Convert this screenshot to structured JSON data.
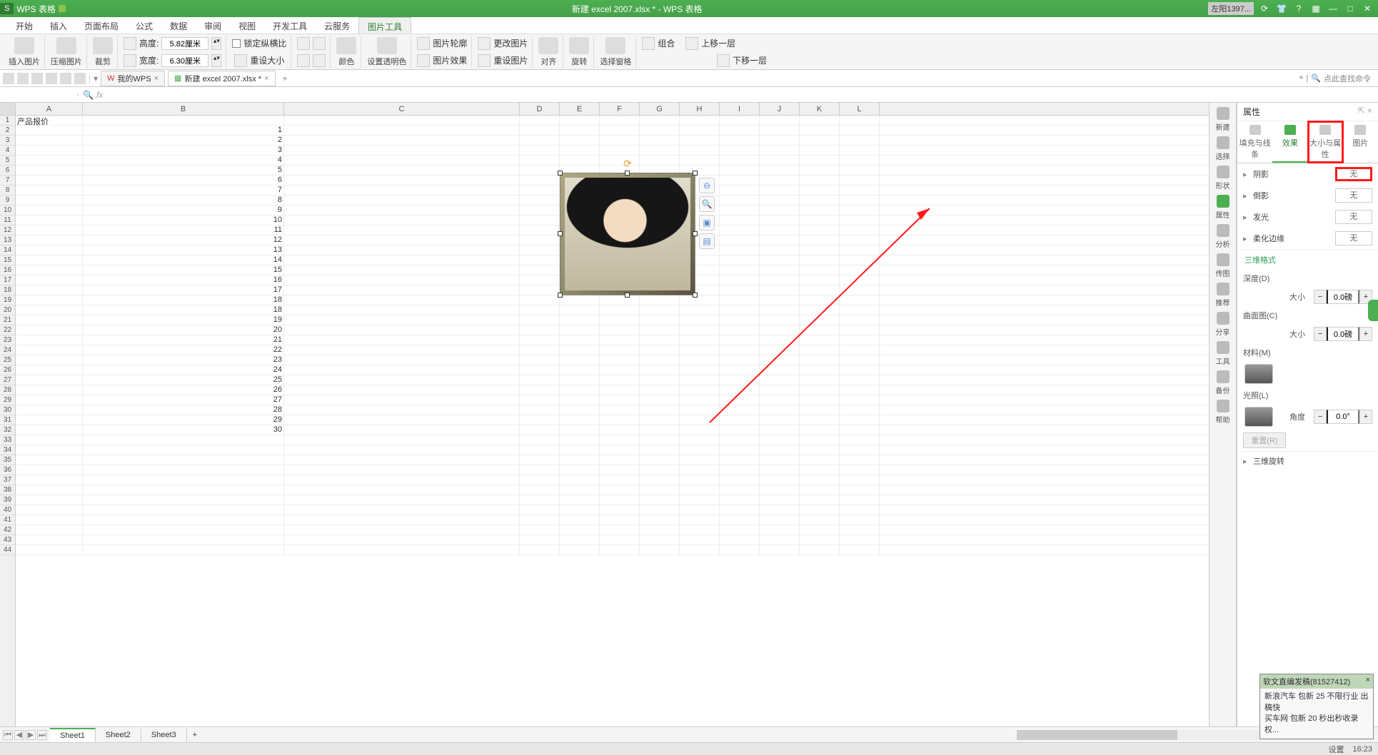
{
  "title": {
    "app": "WPS 表格",
    "doc": "新建 excel 2007.xlsx * - WPS 表格",
    "user": "左阳1397..."
  },
  "menu": {
    "items": [
      "开始",
      "插入",
      "页面布局",
      "公式",
      "数据",
      "审阅",
      "视图",
      "开发工具",
      "云服务",
      "图片工具"
    ],
    "active": 9
  },
  "ribbon": {
    "insertpic": "插入图片",
    "compress": "压缩图片",
    "crop": "裁剪",
    "height_lbl": "高度:",
    "height": "5.82厘米",
    "width_lbl": "宽度:",
    "width": "6.30厘米",
    "lock": "锁定纵横比",
    "resetsize": "重设大小",
    "border": "图片轮廓",
    "effect": "图片效果",
    "resetpic": "重设图片",
    "replace": "更改图片",
    "color": "颜色",
    "opacity": "设置透明色",
    "rotate": "旋转",
    "selpane": "选择窗格",
    "align": "对齐",
    "group": "组合",
    "front": "上移一层",
    "back": "下移一层"
  },
  "qat": {
    "mywps": "我的WPS",
    "doc": "新建 excel 2007.xlsx *",
    "search": "点此查找命令"
  },
  "namebox": "",
  "fx": "fx",
  "cols": [
    "A",
    "B",
    "C",
    "D",
    "E",
    "F",
    "G",
    "H",
    "I",
    "J",
    "K",
    "L"
  ],
  "a1": "产品报价",
  "bvalues": [
    "1",
    "2",
    "3",
    "4",
    "5",
    "6",
    "7",
    "8",
    "9",
    "10",
    "11",
    "12",
    "13",
    "14",
    "15",
    "16",
    "17",
    "18",
    "18",
    "19",
    "20",
    "21",
    "22",
    "23",
    "24",
    "25",
    "26",
    "27",
    "28",
    "29",
    "30"
  ],
  "rail": [
    {
      "l": "新建"
    },
    {
      "l": "选择"
    },
    {
      "l": "形状"
    },
    {
      "l": "属性",
      "g": true
    },
    {
      "l": "分析"
    },
    {
      "l": "传图"
    },
    {
      "l": "推荐"
    },
    {
      "l": "分享"
    },
    {
      "l": "工具"
    },
    {
      "l": "备份"
    },
    {
      "l": "帮助"
    }
  ],
  "props": {
    "title": "属性",
    "tabs": [
      {
        "l": "填充与线条"
      },
      {
        "l": "效果",
        "active": true
      },
      {
        "l": "大小与属性",
        "boxed": true
      },
      {
        "l": "图片"
      }
    ],
    "shadow": {
      "l": "阴影",
      "v": "无",
      "boxed": true
    },
    "reflect": {
      "l": "倒影",
      "v": "无"
    },
    "glow": {
      "l": "发光",
      "v": "无"
    },
    "soft": {
      "l": "柔化边缘",
      "v": "无"
    },
    "d3": "三维格式",
    "depth": {
      "l": "深度(D)",
      "size": "大小",
      "v": "0.0磅"
    },
    "bevel": {
      "l": "曲面图(C)",
      "size": "大小",
      "v": "0.0磅"
    },
    "material": "材料(M)",
    "light": "光照(L)",
    "angle": {
      "l": "角度",
      "v": "0.0°"
    },
    "reset": "重置(R)",
    "rot3d": "三维旋转"
  },
  "notif": {
    "title": "软文直编发稿(81527412)",
    "l1": "新浪汽车 包新 25 不限行业 出稿快",
    "l2": "买车网 包新 20 秒出秒收录 权..."
  },
  "sheets": [
    "Sheet1",
    "Sheet2",
    "Sheet3"
  ],
  "status": {
    "set": "设置",
    "time": "16:23"
  },
  "picfloat": [
    "⊖",
    "🔍",
    "▣",
    "▤"
  ]
}
